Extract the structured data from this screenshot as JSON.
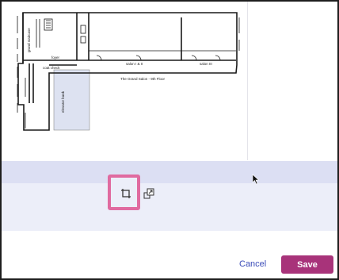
{
  "floor_plan": {
    "room_labels": {
      "grand_staircase": "grand staircase",
      "foyer": "foyer",
      "coat_check": "coat check",
      "salon_1_2": "salon I & II",
      "salon_3": "salon III",
      "elevator_bank": "elevator bank",
      "floor_title": "The Grand Salon - 9th Floor"
    }
  },
  "toolbar": {
    "crop_icon": "crop-icon",
    "replace_icon": "replace-image-icon"
  },
  "actions": {
    "cancel_label": "Cancel",
    "save_label": "Save"
  },
  "colors": {
    "save_bg": "#a8337a",
    "cancel_text": "#3b4cb8",
    "highlight_border": "#e06aa0",
    "band_dark": "#dcdff3",
    "band_light": "#eceef9"
  }
}
